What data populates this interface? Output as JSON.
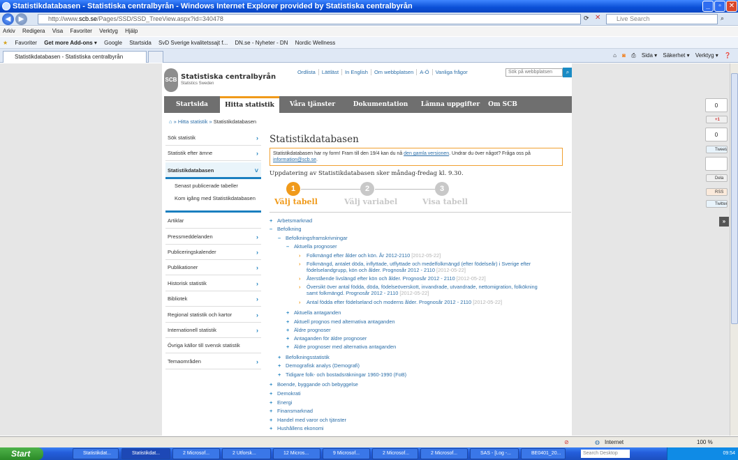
{
  "window": {
    "title": "Statistikdatabasen - Statistiska centralbyrån - Windows Internet Explorer provided by Statistiska centralbyrån"
  },
  "address": {
    "url_prefix": "http://www.",
    "url_domain": "scb.se",
    "url_path": "/Pages/SSD/SSD_TreeView.aspx?id=340478",
    "search_placeholder": "Live Search"
  },
  "menu": [
    "Arkiv",
    "Redigera",
    "Visa",
    "Favoriter",
    "Verktyg",
    "Hjälp"
  ],
  "favorites": {
    "label": "Favoriter",
    "items": [
      "Get more Add-ons ▾",
      "Google",
      "Startsida",
      "SvD Sverige kvalitetssajt f...",
      "DN.se - Nyheter - DN",
      "Nordic Wellness"
    ]
  },
  "tab": {
    "label": "Statistikdatabasen - Statistiska centralbyrån"
  },
  "commands": [
    "Sida ▾",
    "Säkerhet ▾",
    "Verktyg ▾"
  ],
  "header": {
    "logo_text": "SCB",
    "brand": "Statistiska centralbyrån",
    "brand_sub": "Statistics Sweden",
    "links": [
      "Ordlista",
      "Lättläst",
      "In English",
      "Om webbplatsen",
      "A-Ö",
      "Vanliga frågor"
    ],
    "search_placeholder": "Sök på webbplatsen"
  },
  "mainnav": [
    "Startsida",
    "Hitta statistik",
    "Våra tjänster",
    "Dokumentation",
    "Lämna uppgifter",
    "Om SCB"
  ],
  "breadcrumb": {
    "sep1": "»",
    "item1": "Hitta statistik",
    "sep2": "»",
    "current": "Statistikdatabasen"
  },
  "sidebar": [
    {
      "label": "Sök statistik"
    },
    {
      "label": "Statistik efter ämne"
    },
    {
      "label": "Statistikdatabasen"
    },
    {
      "label": "Senast publicerade tabeller"
    },
    {
      "label": "Kom igång med Statistikdatabasen"
    },
    {
      "label": "Artiklar"
    },
    {
      "label": "Pressmeddelanden"
    },
    {
      "label": "Publiceringskalender"
    },
    {
      "label": "Publikationer"
    },
    {
      "label": "Historisk statistik"
    },
    {
      "label": "Bibliotek"
    },
    {
      "label": "Regional statistik och kartor"
    },
    {
      "label": "Internationell statistik"
    },
    {
      "label": "Övriga källor till svensk statistik"
    },
    {
      "label": "Temaområden"
    }
  ],
  "main": {
    "title": "Statistikdatabasen",
    "notice_text1": "Statistikdatabasen har ny form! Fram till den 19/4 kan du nå ",
    "notice_link1": "den gamla versionen",
    "notice_text2": ". Undrar du över något? Fråga oss på ",
    "notice_link2": "information@scb.se",
    "notice_text3": ".",
    "update": "Uppdatering av Statistikdatabasen sker måndag-fredag kl. 9.30.",
    "steps": [
      {
        "num": "1",
        "label": "Välj tabell",
        "color": "#f09a1a"
      },
      {
        "num": "2",
        "label": "Välj variabel",
        "color": "#c8c8c8"
      },
      {
        "num": "3",
        "label": "Visa tabell",
        "color": "#c8c8c8"
      }
    ]
  },
  "tree": [
    {
      "sign": "+",
      "text": "Arbetsmarknad",
      "date": ""
    },
    {
      "sign": "–",
      "text": "Befolkning",
      "date": ""
    },
    {
      "sign": "–",
      "text": "Befolkningsframskrivningar",
      "date": ""
    },
    {
      "sign": "–",
      "text": "Aktuella prognoser",
      "date": ""
    },
    {
      "sign": "›",
      "text": "Folkmängd efter ålder och kön. År 2012-2110",
      "date": "[2012-05-22]"
    },
    {
      "sign": "›",
      "text": "Folkmängd, antalet döda, inflyttade, utflyttade och medelfolkmängd (efter födelseår) i Sverige efter",
      "date": ""
    },
    {
      "sign": "",
      "text": "födelselandgrupp, kön och ålder. Prognosår 2012 - 2110",
      "date": "[2012-05-22]"
    },
    {
      "sign": "›",
      "text": "Återstående livslängd efter kön och ålder. Prognosår 2012 - 2110",
      "date": "[2012-05-22]"
    },
    {
      "sign": "›",
      "text": "Översikt över antal födda, döda, födelseöverskott, invandrade, utvandrade, nettomigration, folkökning",
      "date": ""
    },
    {
      "sign": "",
      "text": "samt folkmängd. Prognosår 2012 - 2110",
      "date": "[2012-05-22]"
    },
    {
      "sign": "›",
      "text": "Antal födda efter födelseland och moderns ålder. Prognosår 2012 - 2110",
      "date": "[2012-05-22]"
    },
    {
      "sign": "+",
      "text": "Aktuella antaganden",
      "date": ""
    },
    {
      "sign": "+",
      "text": "Aktuell prognos med alternativa antaganden",
      "date": ""
    },
    {
      "sign": "+",
      "text": "Äldre prognoser",
      "date": ""
    },
    {
      "sign": "+",
      "text": "Antaganden för äldre prognoser",
      "date": ""
    },
    {
      "sign": "+",
      "text": "Äldre prognoser med alternativa antaganden",
      "date": ""
    },
    {
      "sign": "+",
      "text": "Befolkningsstatistik",
      "date": ""
    },
    {
      "sign": "+",
      "text": "Demografisk analys (Demografi)",
      "date": ""
    },
    {
      "sign": "+",
      "text": "Tidigare folk- och bostadsräkningar 1960-1990 (FoB)",
      "date": ""
    },
    {
      "sign": "+",
      "text": "Boende, byggande och bebyggelse",
      "date": ""
    },
    {
      "sign": "+",
      "text": "Demokrati",
      "date": ""
    },
    {
      "sign": "+",
      "text": "Energi",
      "date": ""
    },
    {
      "sign": "+",
      "text": "Finansmarknad",
      "date": ""
    },
    {
      "sign": "+",
      "text": "Handel med varor och tjänster",
      "date": ""
    },
    {
      "sign": "+",
      "text": "Hushållens ekonomi",
      "date": ""
    }
  ],
  "social": {
    "count1": "0",
    "gplus": "+1",
    "count2": "0",
    "tweet": "Tweeta",
    "share": "Dela",
    "rss": "RSS",
    "twitter": "Twitter",
    "expand": "»"
  },
  "status": {
    "zone": "Internet",
    "zoom": "100 %"
  },
  "taskbar": {
    "start": "Start",
    "tasks": [
      "Statistikdat...",
      "Statistikdat...",
      "2 Microsof...",
      "2 Utforsk...",
      "12 Micros...",
      "9 Microsof...",
      "2 Microsof...",
      "2 Microsof...",
      "SAS - [Log -...",
      "BE0401_20..."
    ],
    "search_placeholder": "Search Desktop",
    "time": "09:54"
  }
}
